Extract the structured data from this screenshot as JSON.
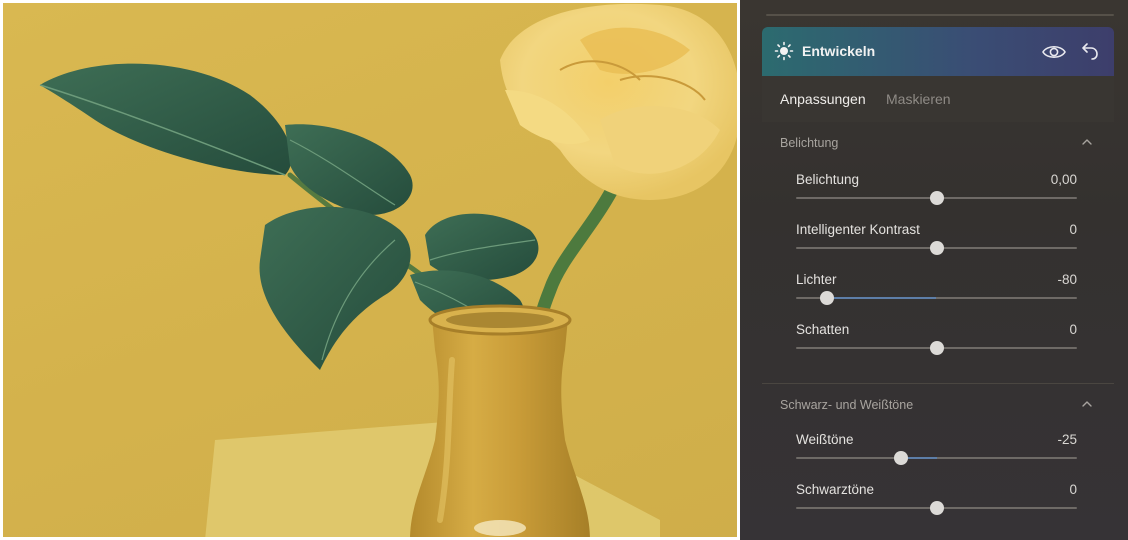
{
  "panel": {
    "title": "Entwickeln",
    "icons": {
      "title": "sun-icon",
      "view": "eye-icon",
      "reset": "undo-icon"
    },
    "tabs": [
      {
        "label": "Anpassungen",
        "active": true
      },
      {
        "label": "Maskieren",
        "active": false
      }
    ],
    "sections": [
      {
        "title": "Belichtung",
        "expanded": true,
        "sliders": [
          {
            "label": "Belichtung",
            "value": "0,00",
            "position": 0.5
          },
          {
            "label": "Intelligenter Kontrast",
            "value": "0",
            "position": 0.5
          },
          {
            "label": "Lichter",
            "value": "-80",
            "position": 0.11
          },
          {
            "label": "Schatten",
            "value": "0",
            "position": 0.5
          }
        ]
      },
      {
        "title": "Schwarz- und Weißtöne",
        "expanded": true,
        "sliders": [
          {
            "label": "Weißtöne",
            "value": "-25",
            "position": 0.375
          },
          {
            "label": "Schwarztöne",
            "value": "0",
            "position": 0.5
          }
        ]
      }
    ]
  },
  "colors": {
    "header_start": "#2c6b6f",
    "header_end": "#3d3e6b",
    "slider_fill": "#5d7ea8",
    "photo_background": "#d9b851"
  }
}
